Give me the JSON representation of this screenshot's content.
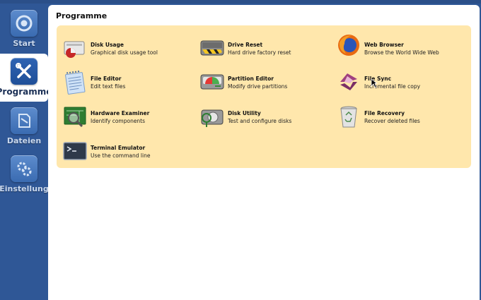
{
  "sidebar": {
    "items": [
      {
        "label": "Start",
        "icon": "start-icon"
      },
      {
        "label": "Programme",
        "icon": "tools-icon",
        "active": true
      },
      {
        "label": "Dateien",
        "icon": "files-icon"
      },
      {
        "label": "Einstellung",
        "icon": "gear-icon"
      }
    ]
  },
  "main": {
    "title": "Programme",
    "apps": [
      {
        "name": "Disk Usage",
        "desc": "Graphical disk usage tool",
        "icon": "disk-usage-icon"
      },
      {
        "name": "Drive Reset",
        "desc": "Hard drive factory reset",
        "icon": "drive-reset-icon"
      },
      {
        "name": "Web Browser",
        "desc": "Browse the World Wide Web",
        "icon": "web-browser-icon"
      },
      {
        "name": "File Editor",
        "desc": "Edit text files",
        "icon": "file-editor-icon"
      },
      {
        "name": "Partition Editor",
        "desc": "Modify drive partitions",
        "icon": "partition-editor-icon"
      },
      {
        "name": "File Sync",
        "desc": "Incremental file copy",
        "icon": "file-sync-icon"
      },
      {
        "name": "Hardware Examiner",
        "desc": "Identify components",
        "icon": "hardware-examiner-icon"
      },
      {
        "name": "Disk Utility",
        "desc": "Test and configure disks",
        "icon": "disk-utility-icon"
      },
      {
        "name": "File Recovery",
        "desc": "Recover deleted files",
        "icon": "file-recovery-icon"
      },
      {
        "name": "Terminal Emulator",
        "desc": "Use the command line",
        "icon": "terminal-icon"
      }
    ]
  },
  "colors": {
    "sidebar_bg": "#2f5796",
    "panel_bg": "#ffe7ac",
    "content_bg": "#ffffff"
  }
}
